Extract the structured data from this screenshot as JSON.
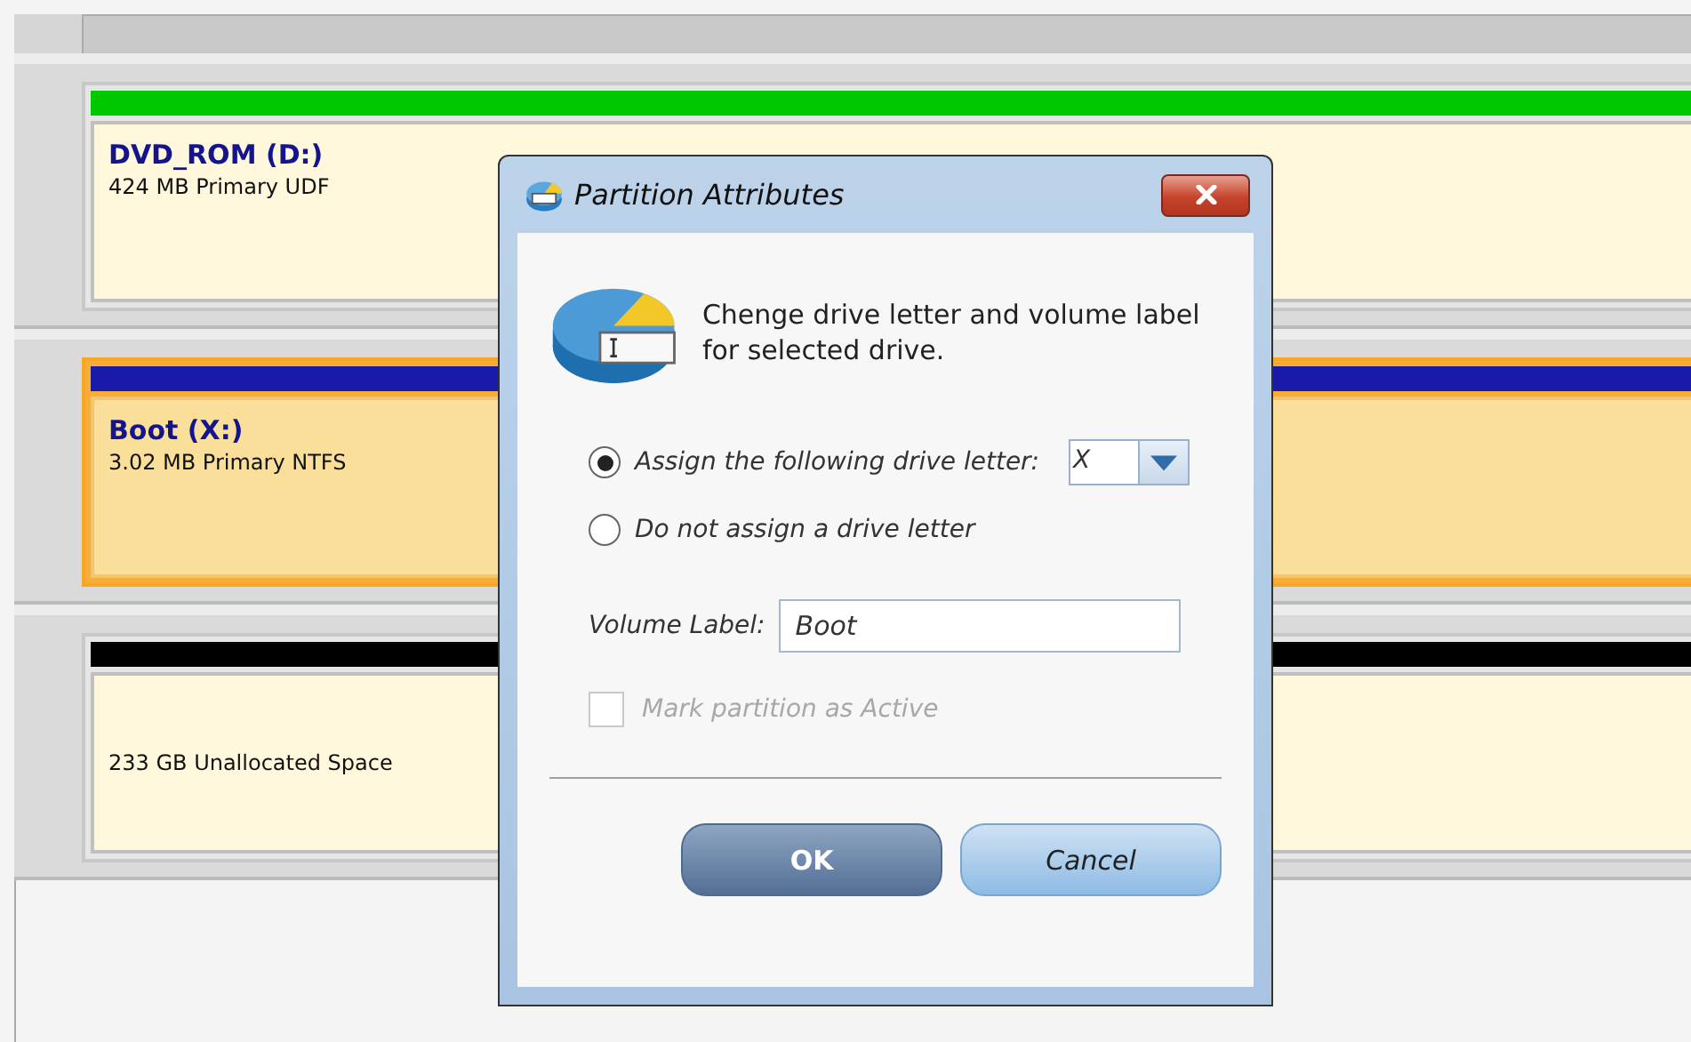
{
  "partitions": [
    {
      "name": "DVD_ROM (D:)",
      "details": "424 MB Primary UDF",
      "color": "#00c800",
      "selected": false
    },
    {
      "name": "Boot (X:)",
      "details": "3.02 MB Primary NTFS",
      "color": "#1a1aa8",
      "selected": true
    },
    {
      "details": "233 GB Unallocated Space",
      "color": "#000000",
      "selected": false
    }
  ],
  "dialog": {
    "title": "Partition Attributes",
    "description": "Chenge drive letter and volume label for selected drive.",
    "options": [
      {
        "label": "Assign the following drive letter:",
        "selected": true,
        "kind": "letter"
      },
      {
        "label": "Do not assign a drive letter",
        "selected": false,
        "kind": "plain"
      }
    ],
    "drive_letter": "X",
    "volume_label": {
      "label": "Volume Label:",
      "value": "Boot"
    },
    "active_checkbox": {
      "label": "Mark partition as Active",
      "checked": false,
      "disabled": true
    },
    "buttons": [
      {
        "label": "OK",
        "kind": "primary"
      },
      {
        "label": "Cancel",
        "kind": "secondary"
      }
    ]
  }
}
